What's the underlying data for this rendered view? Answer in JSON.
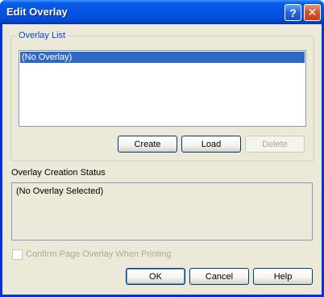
{
  "window": {
    "title": "Edit Overlay"
  },
  "title_buttons": {
    "help_glyph": "?",
    "close_glyph": "✕"
  },
  "overlay_list": {
    "legend": "Overlay List",
    "items": [
      "(No Overlay)"
    ],
    "selected_index": 0
  },
  "list_buttons": {
    "create": "Create",
    "load": "Load",
    "delete": "Delete"
  },
  "status": {
    "label": "Overlay Creation Status",
    "text": "(No Overlay Selected)"
  },
  "confirm_checkbox": {
    "label": "Confirm Page Overlay When Printing",
    "checked": false,
    "enabled": false
  },
  "dialog_buttons": {
    "ok": "OK",
    "cancel": "Cancel",
    "help": "Help"
  },
  "colors": {
    "title_bar": "#0554e3",
    "dialog_bg": "#ece9d8",
    "selection": "#316ac5",
    "group_label": "#0046d5"
  }
}
